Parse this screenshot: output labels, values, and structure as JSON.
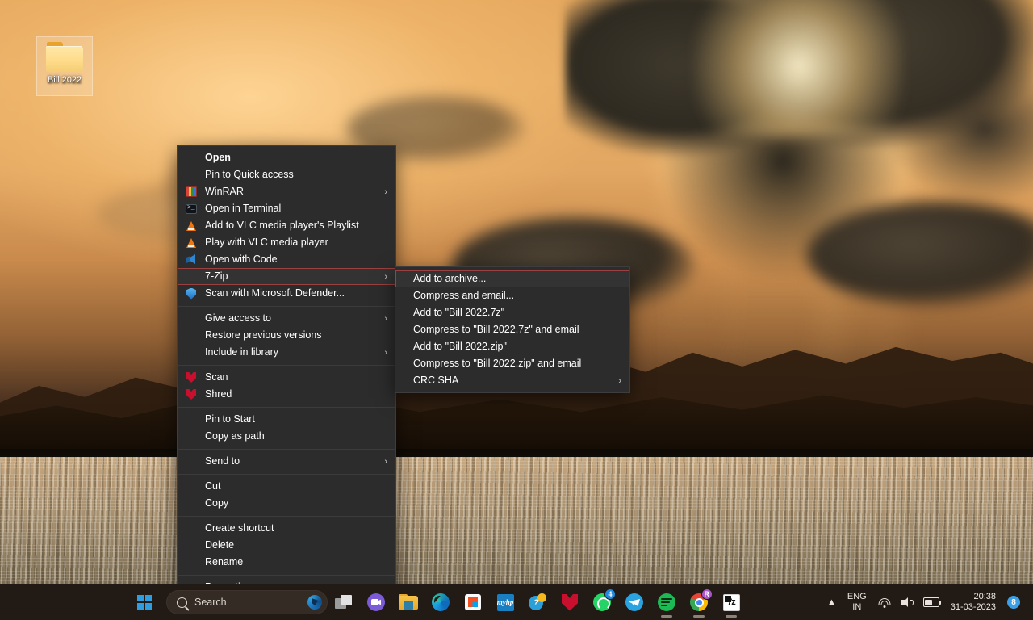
{
  "desktop": {
    "icon": {
      "name": "Bill 2022",
      "type": "folder-icon"
    }
  },
  "context_menu": {
    "items": [
      {
        "label": "Open",
        "icon": null,
        "bold": true,
        "submenu": false,
        "separator_after": false
      },
      {
        "label": "Pin to Quick access",
        "icon": null,
        "bold": false,
        "submenu": false,
        "separator_after": false
      },
      {
        "label": "WinRAR",
        "icon": "winrar-icon",
        "bold": false,
        "submenu": true,
        "separator_after": false
      },
      {
        "label": "Open in Terminal",
        "icon": "terminal-icon",
        "bold": false,
        "submenu": false,
        "separator_after": false
      },
      {
        "label": "Add to VLC media player's Playlist",
        "icon": "vlc-icon",
        "bold": false,
        "submenu": false,
        "separator_after": false
      },
      {
        "label": "Play with VLC media player",
        "icon": "vlc-icon",
        "bold": false,
        "submenu": false,
        "separator_after": false
      },
      {
        "label": "Open with Code",
        "icon": "vscode-icon",
        "bold": false,
        "submenu": false,
        "separator_after": false
      },
      {
        "label": "7-Zip",
        "icon": null,
        "bold": false,
        "submenu": true,
        "separator_after": false,
        "highlighted": true
      },
      {
        "label": "Scan with Microsoft Defender...",
        "icon": "defender-shield-icon",
        "bold": false,
        "submenu": false,
        "separator_after": true
      },
      {
        "label": "Give access to",
        "icon": null,
        "bold": false,
        "submenu": true,
        "separator_after": false
      },
      {
        "label": "Restore previous versions",
        "icon": null,
        "bold": false,
        "submenu": false,
        "separator_after": false
      },
      {
        "label": "Include in library",
        "icon": null,
        "bold": false,
        "submenu": true,
        "separator_after": true
      },
      {
        "label": "Scan",
        "icon": "mcafee-icon",
        "bold": false,
        "submenu": false,
        "separator_after": false
      },
      {
        "label": "Shred",
        "icon": "mcafee-icon",
        "bold": false,
        "submenu": false,
        "separator_after": true
      },
      {
        "label": "Pin to Start",
        "icon": null,
        "bold": false,
        "submenu": false,
        "separator_after": false
      },
      {
        "label": "Copy as path",
        "icon": null,
        "bold": false,
        "submenu": false,
        "separator_after": true
      },
      {
        "label": "Send to",
        "icon": null,
        "bold": false,
        "submenu": true,
        "separator_after": true
      },
      {
        "label": "Cut",
        "icon": null,
        "bold": false,
        "submenu": false,
        "separator_after": false
      },
      {
        "label": "Copy",
        "icon": null,
        "bold": false,
        "submenu": false,
        "separator_after": true
      },
      {
        "label": "Create shortcut",
        "icon": null,
        "bold": false,
        "submenu": false,
        "separator_after": false
      },
      {
        "label": "Delete",
        "icon": null,
        "bold": false,
        "submenu": false,
        "separator_after": false
      },
      {
        "label": "Rename",
        "icon": null,
        "bold": false,
        "submenu": false,
        "separator_after": true
      },
      {
        "label": "Properties",
        "icon": null,
        "bold": false,
        "submenu": false,
        "separator_after": false
      }
    ]
  },
  "submenu": {
    "title": "7-Zip",
    "items": [
      {
        "label": "Add to archive...",
        "submenu": false,
        "highlighted": true
      },
      {
        "label": "Compress and email...",
        "submenu": false,
        "highlighted": false
      },
      {
        "label": "Add to \"Bill 2022.7z\"",
        "submenu": false,
        "highlighted": false
      },
      {
        "label": "Compress to \"Bill 2022.7z\" and email",
        "submenu": false,
        "highlighted": false
      },
      {
        "label": "Add to \"Bill 2022.zip\"",
        "submenu": false,
        "highlighted": false
      },
      {
        "label": "Compress to \"Bill 2022.zip\" and email",
        "submenu": false,
        "highlighted": false
      },
      {
        "label": "CRC SHA",
        "submenu": true,
        "highlighted": false
      }
    ]
  },
  "taskbar": {
    "start": {
      "name": "start-button"
    },
    "search": {
      "placeholder": "Search",
      "icon": "search-icon",
      "copilot_icon": "copilot-icon"
    },
    "apps": [
      {
        "name": "task-view",
        "running": false,
        "badge": null
      },
      {
        "name": "microsoft-teams",
        "running": false,
        "badge": null
      },
      {
        "name": "file-explorer",
        "running": false,
        "badge": null
      },
      {
        "name": "microsoft-edge",
        "running": false,
        "badge": null
      },
      {
        "name": "microsoft-store",
        "running": false,
        "badge": null
      },
      {
        "name": "myhp",
        "running": false,
        "badge": null
      },
      {
        "name": "hp-support-assistant",
        "running": false,
        "badge": null
      },
      {
        "name": "mcafee",
        "running": false,
        "badge": null
      },
      {
        "name": "whatsapp",
        "running": false,
        "badge": "4"
      },
      {
        "name": "telegram",
        "running": false,
        "badge": null
      },
      {
        "name": "spotify",
        "running": true,
        "badge": null
      },
      {
        "name": "google-chrome",
        "running": true,
        "badge": "R"
      },
      {
        "name": "7-zip",
        "running": true,
        "badge": null
      }
    ],
    "tray": {
      "show_hidden_icons": "show-hidden-icons-chevron",
      "language_line1": "ENG",
      "language_line2": "IN",
      "network_icon": "wifi-icon",
      "volume_icon": "speaker-icon",
      "battery_icon": "battery-icon",
      "time": "20:38",
      "date": "31-03-2023",
      "notification_count": "8"
    }
  },
  "colors": {
    "menu_bg": "#2c2c2c",
    "menu_border": "#3d3d3d",
    "highlight_border": "#9b4040",
    "taskbar_bg": "#211a15",
    "accent": "#2d9fe0",
    "badge_whatsapp": "#1f8ae0",
    "badge_chrome": "#a855c7",
    "notification_badge": "#3aa0e8"
  }
}
